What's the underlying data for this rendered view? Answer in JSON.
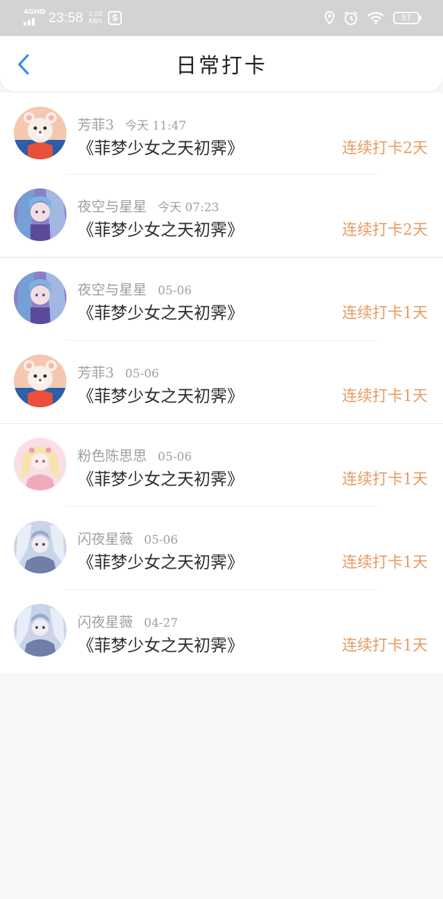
{
  "status_bar": {
    "network": "4GHD",
    "time": "23:58",
    "speed_value": "1.00",
    "speed_unit": "KB/s",
    "battery": "57",
    "icons": [
      "location-icon",
      "alarm-icon",
      "wifi-icon",
      "battery-icon"
    ]
  },
  "header": {
    "title": "日常打卡",
    "back_icon": "chevron-left-icon",
    "accent": "#2d8cf0"
  },
  "colors": {
    "streak": "#e89a5f",
    "meta": "#9e9e9e",
    "title": "#2d2d2d"
  },
  "checkins": [
    {
      "name": "芳菲3",
      "date": "今天 11:47",
      "title": "《菲梦少女之天初霁》",
      "streak": "连续打卡2天",
      "avatar": "bear-avatar"
    },
    {
      "name": "夜空与星星",
      "date": "今天 07:23",
      "title": "《菲梦少女之天初霁》",
      "streak": "连续打卡2天",
      "avatar": "purple-girl-avatar"
    },
    {
      "name": "夜空与星星",
      "date": "05-06",
      "title": "《菲梦少女之天初霁》",
      "streak": "连续打卡1天",
      "avatar": "purple-girl-avatar"
    },
    {
      "name": "芳菲3",
      "date": "05-06",
      "title": "《菲梦少女之天初霁》",
      "streak": "连续打卡1天",
      "avatar": "bear-avatar"
    },
    {
      "name": "粉色陈思思",
      "date": "05-06",
      "title": "《菲梦少女之天初霁》",
      "streak": "连续打卡1天",
      "avatar": "pink-girl-avatar"
    },
    {
      "name": "闪夜星薇",
      "date": "05-06",
      "title": "《菲梦少女之天初霁》",
      "streak": "连续打卡1天",
      "avatar": "blue-girl-avatar"
    },
    {
      "name": "闪夜星薇",
      "date": "04-27",
      "title": "《菲梦少女之天初霁》",
      "streak": "连续打卡1天",
      "avatar": "blue-girl-avatar"
    }
  ]
}
